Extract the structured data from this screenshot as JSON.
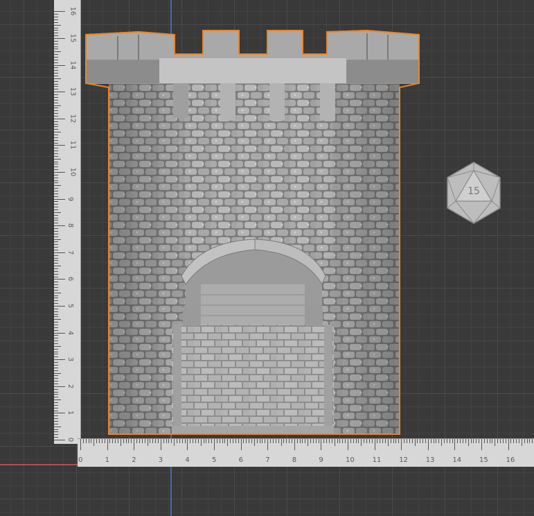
{
  "viewport": {
    "background": "#393939",
    "axis_colors": {
      "x": "#c8525a",
      "y": "#4a6fb8"
    },
    "selection_outline": "#e8862a"
  },
  "ruler_vertical": {
    "labels": [
      "0",
      "1",
      "2",
      "3",
      "4",
      "5",
      "6",
      "7",
      "8",
      "9",
      "10",
      "11",
      "12",
      "13",
      "14",
      "15",
      "16"
    ]
  },
  "ruler_horizontal": {
    "labels": [
      "0",
      "1",
      "2",
      "3",
      "4",
      "5",
      "6",
      "7",
      "8",
      "9",
      "10",
      "11",
      "12",
      "13",
      "14",
      "15",
      "16"
    ]
  },
  "objects": [
    {
      "name": "stone-tower-model",
      "selected": true,
      "icon": "tower-icon"
    },
    {
      "name": "d20-die-model",
      "selected": false,
      "icon": "d20-icon",
      "face_label": "15"
    }
  ]
}
